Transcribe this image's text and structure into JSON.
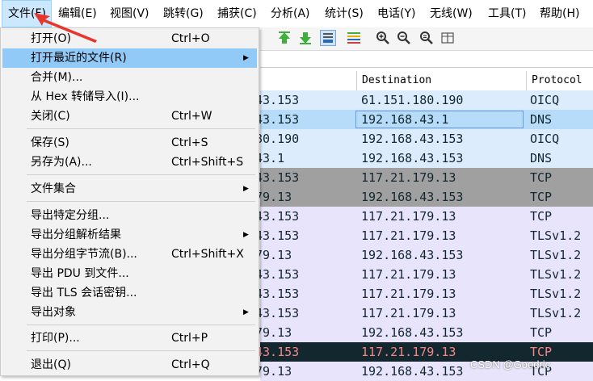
{
  "menubar": {
    "items": [
      "文件(F)",
      "编辑(E)",
      "视图(V)",
      "跳转(G)",
      "捕获(C)",
      "分析(A)",
      "统计(S)",
      "电话(Y)",
      "无线(W)",
      "工具(T)",
      "帮助(H)"
    ]
  },
  "file_menu": {
    "open": {
      "label": "打开(O)",
      "shortcut": "Ctrl+O"
    },
    "open_recent": {
      "label": "打开最近的文件(R)"
    },
    "merge": {
      "label": "合并(M)..."
    },
    "import_hex": {
      "label": "从 Hex 转储导入(I)..."
    },
    "close": {
      "label": "关闭(C)",
      "shortcut": "Ctrl+W"
    },
    "save": {
      "label": "保存(S)",
      "shortcut": "Ctrl+S"
    },
    "save_as": {
      "label": "另存为(A)...",
      "shortcut": "Ctrl+Shift+S"
    },
    "file_set": {
      "label": "文件集合"
    },
    "export_specified": {
      "label": "导出特定分组..."
    },
    "export_dissections": {
      "label": "导出分组解析结果"
    },
    "export_bytes": {
      "label": "导出分组字节流(B)...",
      "shortcut": "Ctrl+Shift+X"
    },
    "export_pdu": {
      "label": "导出 PDU 到文件..."
    },
    "export_tls_keys": {
      "label": "导出 TLS 会话密钥..."
    },
    "export_objects": {
      "label": "导出对象"
    },
    "print": {
      "label": "打印(P)...",
      "shortcut": "Ctrl+P"
    },
    "quit": {
      "label": "退出(Q)",
      "shortcut": "Ctrl+Q"
    }
  },
  "packet_list": {
    "columns": {
      "destination": "Destination",
      "protocol": "Protocol"
    },
    "rows": [
      {
        "src": "43.153",
        "dst": "61.151.180.190",
        "proto": "OICQ",
        "bg": "#dcecfc",
        "fg": "#12272e"
      },
      {
        "src": "43.153",
        "dst": "192.168.43.1",
        "proto": "DNS",
        "bg": "#b7dcf9",
        "fg": "#12272e"
      },
      {
        "src": "80.190",
        "dst": "192.168.43.153",
        "proto": "OICQ",
        "bg": "#dcecfc",
        "fg": "#12272e"
      },
      {
        "src": "43.1",
        "dst": "192.168.43.153",
        "proto": "DNS",
        "bg": "#dcecfc",
        "fg": "#12272e"
      },
      {
        "src": "43.153",
        "dst": "117.21.179.13",
        "proto": "TCP",
        "bg": "#a0a0a0",
        "fg": "#12272e"
      },
      {
        "src": "79.13",
        "dst": "192.168.43.153",
        "proto": "TCP",
        "bg": "#a0a0a0",
        "fg": "#12272e"
      },
      {
        "src": "43.153",
        "dst": "117.21.179.13",
        "proto": "TCP",
        "bg": "#e8e4fb",
        "fg": "#12272e"
      },
      {
        "src": "43.153",
        "dst": "117.21.179.13",
        "proto": "TLSv1.2",
        "bg": "#e8e4fb",
        "fg": "#12272e"
      },
      {
        "src": "79.13",
        "dst": "192.168.43.153",
        "proto": "TLSv1.2",
        "bg": "#e8e4fb",
        "fg": "#12272e"
      },
      {
        "src": "43.153",
        "dst": "117.21.179.13",
        "proto": "TLSv1.2",
        "bg": "#e8e4fb",
        "fg": "#12272e"
      },
      {
        "src": "43.153",
        "dst": "117.21.179.13",
        "proto": "TLSv1.2",
        "bg": "#e8e4fb",
        "fg": "#12272e"
      },
      {
        "src": "43.153",
        "dst": "117.21.179.13",
        "proto": "TLSv1.2",
        "bg": "#e8e4fb",
        "fg": "#12272e"
      },
      {
        "src": "79.13",
        "dst": "192.168.43.153",
        "proto": "TCP",
        "bg": "#e8e4fb",
        "fg": "#12272e"
      },
      {
        "src": "43.153",
        "dst": "117.21.179.13",
        "proto": "TCP",
        "bg": "#12272e",
        "fg": "#f78787"
      },
      {
        "src": "79.13",
        "dst": "192.168.43.153",
        "proto": "TCP",
        "bg": "#e8e4fb",
        "fg": "#12272e"
      }
    ]
  },
  "watermark": "CSDN @Goodric",
  "colors": {
    "menu_highlight": "#91c9f7",
    "menubar_active": "#cce8ff",
    "pointer_arrow": "#e8362c"
  }
}
